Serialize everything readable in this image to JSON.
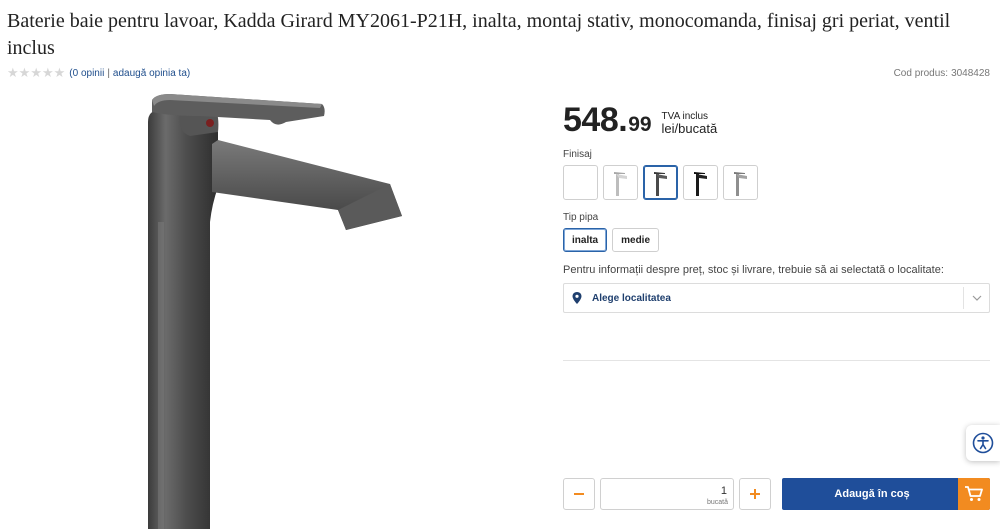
{
  "product": {
    "title": "Baterie baie pentru lavoar, Kadda Girard MY2061-P21H, inalta, montaj stativ, monocomanda, finisaj gri periat, ventil inclus",
    "code_label": "Cod produs:",
    "code_value": "3048428",
    "image_alt": "Baterie baie lavoar gri periat"
  },
  "rating": {
    "stars_filled": 0,
    "stars_total": 5,
    "reviews_link": "(0 opinii",
    "separator": "|",
    "add_review_link": "adaugă opinia ta)"
  },
  "price": {
    "integer": "548.",
    "decimals": "99",
    "vat": "TVA inclus",
    "unit": "lei/bucată"
  },
  "finisaj": {
    "label": "Finisaj",
    "options": [
      {
        "name": "blank",
        "color": "#ffffff"
      },
      {
        "name": "crom",
        "color": "#c9c9c9"
      },
      {
        "name": "gri-periat",
        "color": "#4a4a4a"
      },
      {
        "name": "negru",
        "color": "#1a1a1a"
      },
      {
        "name": "inox",
        "color": "#9a9a9a"
      }
    ],
    "selected_index": 2
  },
  "tip_pipa": {
    "label": "Tip pipa",
    "options": [
      "inalta",
      "medie"
    ],
    "selected": "inalta"
  },
  "location": {
    "info": "Pentru informații despre preț, stoc și livrare, trebuie să ai selectată o localitate:",
    "placeholder": "Alege localitatea"
  },
  "quantity": {
    "value": "1",
    "unit": "bucată",
    "minus": "−",
    "plus": "+"
  },
  "cart": {
    "label": "Adaugă în coș"
  },
  "colors": {
    "accent_blue": "#1f4e9a",
    "accent_orange": "#f28b20",
    "link_blue": "#1f4e8c"
  }
}
